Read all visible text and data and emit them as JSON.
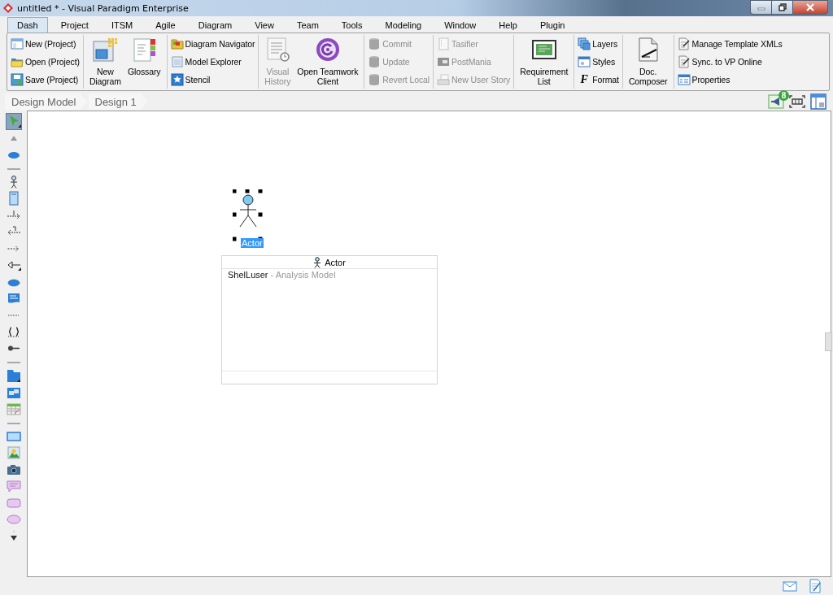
{
  "window": {
    "title": "untitled * - Visual Paradigm Enterprise"
  },
  "tabs": [
    {
      "label": "Dash",
      "selected": true
    },
    {
      "label": "Project",
      "selected": false
    },
    {
      "label": "ITSM",
      "selected": false
    },
    {
      "label": "Agile",
      "selected": false
    },
    {
      "label": "Diagram",
      "selected": false
    },
    {
      "label": "View",
      "selected": false
    },
    {
      "label": "Team",
      "selected": false
    },
    {
      "label": "Tools",
      "selected": false
    },
    {
      "label": "Modeling",
      "selected": false
    },
    {
      "label": "Window",
      "selected": false
    },
    {
      "label": "Help",
      "selected": false
    },
    {
      "label": "Plugin",
      "selected": false
    }
  ],
  "ribbon": {
    "groups": [
      {
        "items": [
          {
            "kind": "small",
            "label": "New (Project)",
            "disabled": false
          },
          {
            "kind": "small",
            "label": "Open (Project)",
            "disabled": false
          },
          {
            "kind": "small",
            "label": "Save (Project)",
            "disabled": false
          }
        ]
      },
      {
        "items": [
          {
            "kind": "large",
            "lines": [
              "New",
              "Diagram"
            ],
            "disabled": false
          },
          {
            "kind": "large",
            "lines": [
              "Glossary"
            ],
            "disabled": false
          }
        ]
      },
      {
        "items": [
          {
            "kind": "small",
            "label": "Diagram Navigator",
            "disabled": false
          },
          {
            "kind": "small",
            "label": "Model Explorer",
            "disabled": false
          },
          {
            "kind": "small",
            "label": "Stencil",
            "disabled": false
          }
        ]
      },
      {
        "items": [
          {
            "kind": "large",
            "lines": [
              "Visual",
              "History"
            ],
            "disabled": true
          },
          {
            "kind": "large",
            "lines": [
              "Open Teamwork",
              "Client"
            ],
            "disabled": false
          }
        ]
      },
      {
        "items": [
          {
            "kind": "small",
            "label": "Commit",
            "disabled": true
          },
          {
            "kind": "small",
            "label": "Update",
            "disabled": true
          },
          {
            "kind": "small",
            "label": "Revert Local",
            "disabled": true
          }
        ]
      },
      {
        "items": [
          {
            "kind": "small",
            "label": "Tasifier",
            "disabled": true
          },
          {
            "kind": "small",
            "label": "PostMania",
            "disabled": true
          },
          {
            "kind": "small",
            "label": "New User Story",
            "disabled": true
          }
        ]
      },
      {
        "items": [
          {
            "kind": "large",
            "lines": [
              "Requirement",
              "List"
            ],
            "disabled": false
          }
        ]
      },
      {
        "items": [
          {
            "kind": "small",
            "label": "Layers",
            "disabled": false
          },
          {
            "kind": "small",
            "label": "Styles",
            "disabled": false
          },
          {
            "kind": "glyph",
            "glyph": "F",
            "label": "Format",
            "disabled": false
          }
        ]
      },
      {
        "items": [
          {
            "kind": "large",
            "lines": [
              "Doc.",
              "Composer"
            ],
            "disabled": false
          }
        ]
      },
      {
        "items": [
          {
            "kind": "small",
            "label": "Manage Template XMLs",
            "disabled": false
          },
          {
            "kind": "small",
            "label": "Sync. to VP Online",
            "disabled": false
          },
          {
            "kind": "small",
            "label": "Properties",
            "disabled": false
          }
        ]
      }
    ]
  },
  "breadcrumb": [
    {
      "label": "Design Model"
    },
    {
      "label": "Design 1"
    }
  ],
  "notifications": {
    "count": "8"
  },
  "palette": [
    {
      "kind": "pointer",
      "selected": true
    },
    {
      "kind": "scroll-up",
      "selected": false
    },
    {
      "kind": "use-case",
      "selected": false
    },
    {
      "kind": "separator"
    },
    {
      "kind": "actor",
      "selected": false
    },
    {
      "kind": "system",
      "selected": false
    },
    {
      "kind": "include",
      "selected": false
    },
    {
      "kind": "extend",
      "selected": false
    },
    {
      "kind": "dependency",
      "selected": false
    },
    {
      "kind": "generalization",
      "selected": false
    },
    {
      "kind": "blob",
      "selected": false
    },
    {
      "kind": "note",
      "selected": false
    },
    {
      "kind": "dotted",
      "selected": false
    },
    {
      "kind": "braces",
      "selected": false
    },
    {
      "kind": "lollipop",
      "selected": false
    },
    {
      "kind": "separator"
    },
    {
      "kind": "folder",
      "selected": false
    },
    {
      "kind": "windows",
      "selected": false
    },
    {
      "kind": "table",
      "selected": false
    },
    {
      "kind": "separator"
    },
    {
      "kind": "rect",
      "selected": false
    },
    {
      "kind": "image",
      "selected": false
    },
    {
      "kind": "camera",
      "selected": false
    },
    {
      "kind": "callout",
      "selected": false
    },
    {
      "kind": "rounded",
      "selected": false
    },
    {
      "kind": "oval",
      "selected": false
    },
    {
      "kind": "scroll-down",
      "selected": false
    }
  ],
  "canvas": {
    "actor": {
      "label": "Actor",
      "selected": true
    },
    "popup": {
      "title": "Actor",
      "owner": "ShelLuser",
      "model": "- Analysis Model"
    }
  }
}
